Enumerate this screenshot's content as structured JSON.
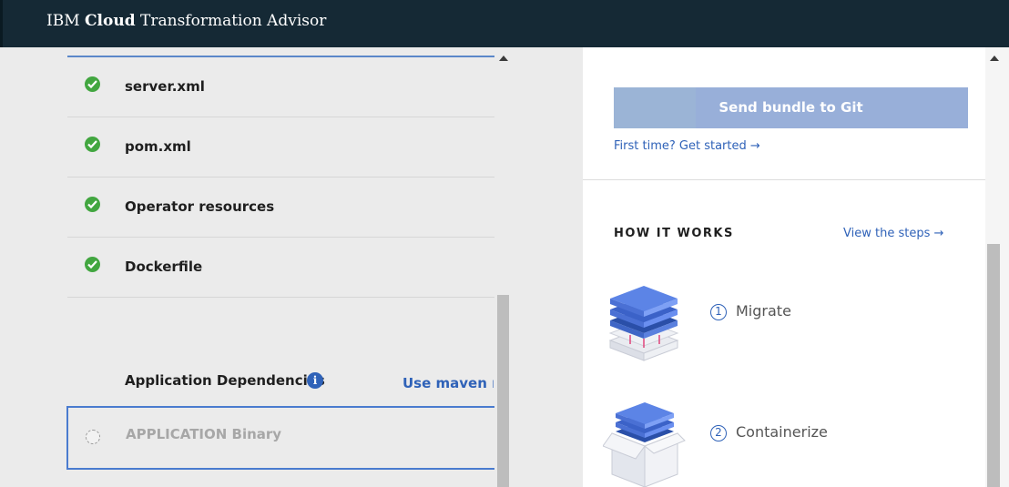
{
  "header": {
    "brand_prefix": "IBM",
    "brand_bold": "Cloud",
    "brand_suffix": "Transformation Advisor"
  },
  "files": [
    {
      "name": "server.xml",
      "status": "complete"
    },
    {
      "name": "pom.xml",
      "status": "complete"
    },
    {
      "name": "Operator resources",
      "status": "complete"
    },
    {
      "name": "Dockerfile",
      "status": "complete"
    }
  ],
  "dependencies": {
    "title": "Application Dependencies",
    "info_icon": "info-icon",
    "maven_link": "Use maven re",
    "items": [
      {
        "label": "APPLICATION Binary",
        "selected": false
      }
    ]
  },
  "git": {
    "button_label": "Send bundle to Git",
    "first_time_link": "First time? Get started →"
  },
  "how_it_works": {
    "title": "HOW IT WORKS",
    "view_steps": "View the steps →",
    "steps": [
      {
        "num": "1",
        "label": "Migrate",
        "icon": "server-stack-icon"
      },
      {
        "num": "2",
        "label": "Containerize",
        "icon": "container-box-icon"
      }
    ]
  },
  "colors": {
    "header_bg": "#152935",
    "accent": "#2f62b8",
    "success": "#42a640",
    "button_disabled": "#98afd9"
  }
}
